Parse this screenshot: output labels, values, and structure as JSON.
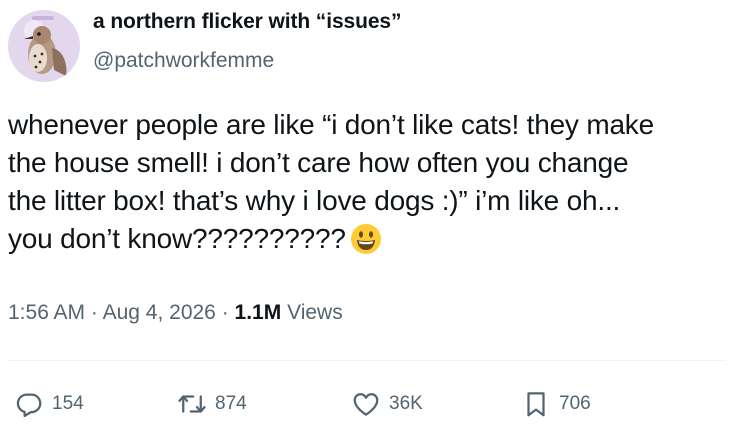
{
  "author": {
    "display_name": "a northern flicker with “issues”",
    "handle": "@patchworkfemme",
    "avatar_icon": "bird-avatar"
  },
  "tweet": {
    "lines": [
      "whenever people are like “i don’t like cats! they make",
      "the house smell! i don’t care how often you change",
      "the litter box! that’s why i love dogs :)” i’m like oh...",
      "you don’t know??????????"
    ],
    "emoji": "grinning-face-emoji"
  },
  "meta": {
    "time": "1:56 AM",
    "date": "Aug 4, 2026",
    "separator": "·",
    "views_count": "1.1M",
    "views_label": "Views"
  },
  "actions": {
    "replies": "154",
    "reposts": "874",
    "likes": "36K",
    "bookmarks": "706"
  },
  "colors": {
    "text": "#0f1419",
    "secondary": "#536471",
    "divider": "#eff3f4",
    "emoji": "#ffcc33"
  }
}
